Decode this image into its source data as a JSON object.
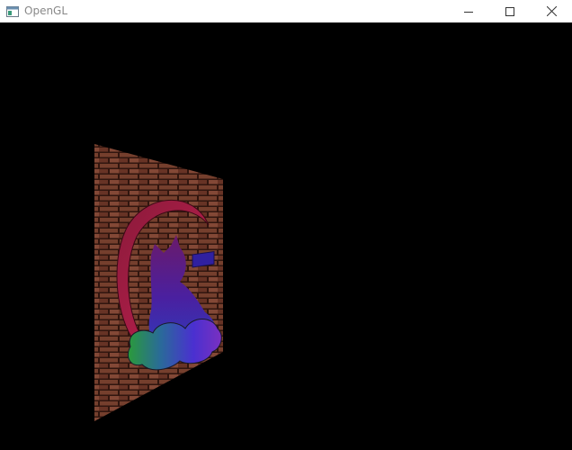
{
  "window": {
    "title": "OpenGL",
    "icon": "opengl-app-icon"
  },
  "controls": {
    "minimize_icon": "minimize-icon",
    "maximize_icon": "maximize-icon",
    "close_icon": "close-icon"
  },
  "scene": {
    "background_color": "#000000",
    "quad_texture": "brick-wall",
    "overlay_texture": "logo-silhouette"
  }
}
